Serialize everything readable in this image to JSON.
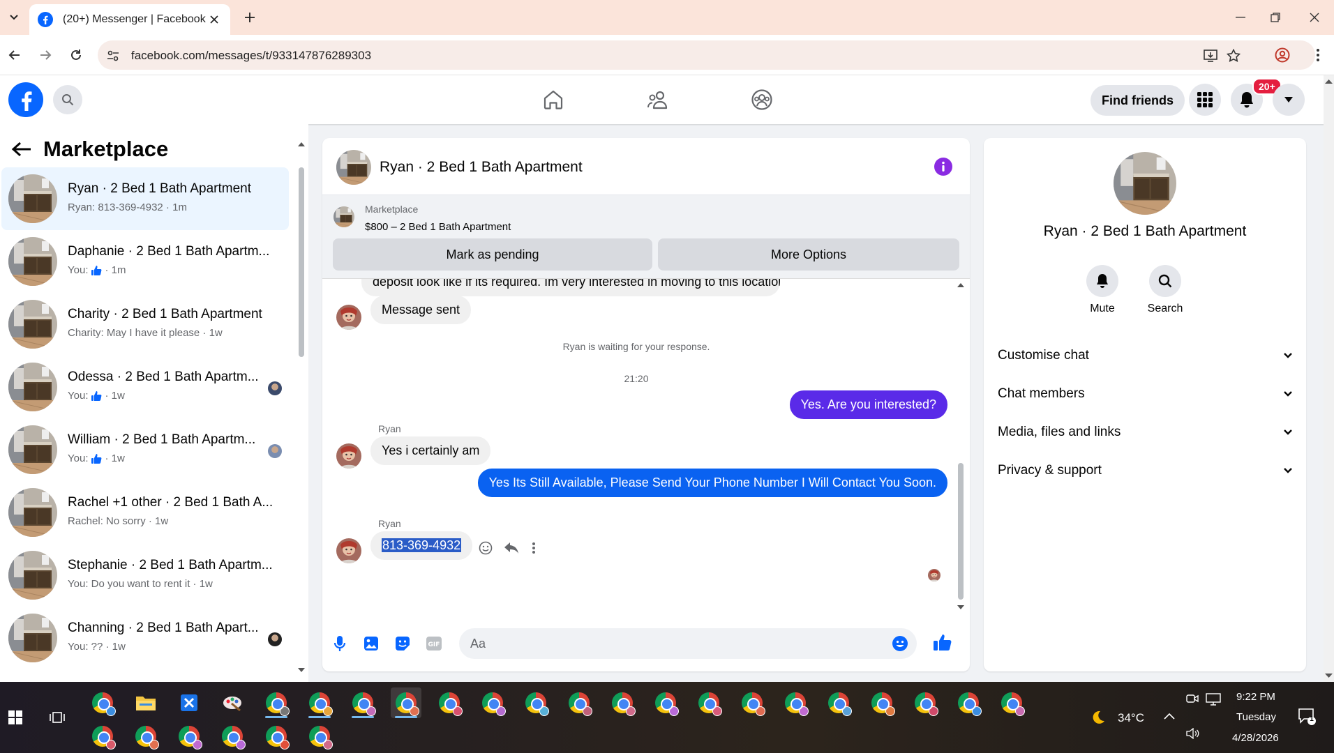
{
  "browser": {
    "tab_title": "(20+) Messenger | Facebook",
    "url": "facebook.com/messages/t/933147876289303"
  },
  "fb_header": {
    "find_friends": "Find friends",
    "notification_badge": "20+"
  },
  "sidebar": {
    "title": "Marketplace",
    "conversations": [
      {
        "name": "Ryan · 2 Bed 1 Bath Apartment",
        "preview": "Ryan: 813-369-4932 · 1m",
        "active": true
      },
      {
        "name": "Daphanie · 2 Bed 1 Bath Apartm...",
        "preview_prefix": "You:",
        "preview_suffix": "· 1m",
        "like": true
      },
      {
        "name": "Charity · 2 Bed 1 Bath Apartment",
        "preview": "Charity: May I have it please · 1w"
      },
      {
        "name": "Odessa · 2 Bed 1 Bath Apartm...",
        "preview_prefix": "You:",
        "preview_suffix": "· 1w",
        "like": true
      },
      {
        "name": "William · 2 Bed 1 Bath Apartm...",
        "preview_prefix": "You:",
        "preview_suffix": "· 1w",
        "like": true
      },
      {
        "name": "Rachel +1 other · 2 Bed 1 Bath A...",
        "preview": "Rachel: No sorry · 1w"
      },
      {
        "name": "Stephanie · 2 Bed 1 Bath Apartm...",
        "preview": "You: Do you want to rent it · 1w"
      },
      {
        "name": "Channing · 2 Bed 1 Bath Apart...",
        "preview": "You: ?? · 1w"
      }
    ]
  },
  "chat": {
    "title": "Ryan · 2 Bed 1 Bath Apartment",
    "marketplace_label": "Marketplace",
    "listing": "$800 – 2 Bed 1 Bath Apartment",
    "mark_pending": "Mark as pending",
    "more_options": "More Options",
    "partial_message": "deposit look like if its required. Im very interested in moving to this location.",
    "message_sent": "Message sent",
    "waiting_notice": "Ryan is waiting for your response.",
    "timestamp": "21:20",
    "out_1": "Yes. Are you interested?",
    "sender_1": "Ryan",
    "in_1": "Yes i certainly am",
    "out_2": "Yes Its Still Available, Please Send Your Phone Number I Will Contact You Soon.",
    "sender_2": "Ryan",
    "in_2": "813-369-4932",
    "input_placeholder": "Aa",
    "colors": {
      "out_blue": "#0a62f1",
      "out_purple": "#5a2ae8",
      "accent": "#7b2cf0"
    }
  },
  "info_panel": {
    "name": "Ryan · 2 Bed 1 Bath Apartment",
    "mute": "Mute",
    "search": "Search",
    "sections": [
      "Customise chat",
      "Chat members",
      "Media, files and links",
      "Privacy & support"
    ]
  },
  "taskbar": {
    "weather": "34°C",
    "time": "9:22 PM",
    "day": "Tuesday",
    "date": "4/28/2026",
    "notification_count": "1"
  }
}
